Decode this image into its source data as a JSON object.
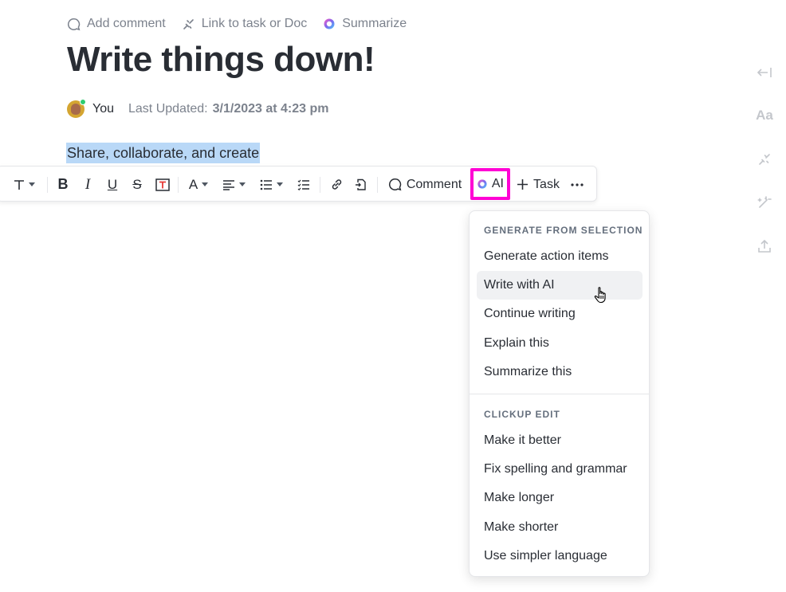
{
  "topbar": {
    "add_comment": "Add comment",
    "link_task": "Link to task or Doc",
    "summarize": "Summarize"
  },
  "doc": {
    "title": "Write things down!",
    "author": "You",
    "last_updated_label": "Last Updated:",
    "last_updated_value": "3/1/2023 at 4:23 pm",
    "selected_text": "Share, collaborate, and create"
  },
  "toolbar": {
    "comment_label": "Comment",
    "ai_label": "AI",
    "task_label": "Task",
    "buttons": [
      "text-style",
      "bold",
      "italic",
      "underline",
      "strikethrough",
      "text-highlight",
      "font-color",
      "align",
      "bulleted-list",
      "checklist",
      "link",
      "embed",
      "comment",
      "ai",
      "task",
      "more"
    ]
  },
  "right_rail": {
    "icons": [
      "collapse-icon",
      "typography-icon",
      "link-icon",
      "magic-icon",
      "share-icon"
    ],
    "typography_label": "Aa"
  },
  "ai_menu": {
    "section1_title": "GENERATE FROM SELECTION",
    "section1_items": [
      "Generate action items",
      "Write with AI",
      "Continue writing",
      "Explain this",
      "Summarize this"
    ],
    "section2_title": "CLICKUP EDIT",
    "section2_items": [
      "Make it better",
      "Fix spelling and grammar",
      "Make longer",
      "Make shorter",
      "Use simpler language"
    ],
    "hovered_item": "Write with AI"
  },
  "colors": {
    "selection_highlight": "#b9d8f7",
    "ai_button_outline": "#ff00d4",
    "muted_text": "#7c828d",
    "online_status": "#2ecc71"
  }
}
